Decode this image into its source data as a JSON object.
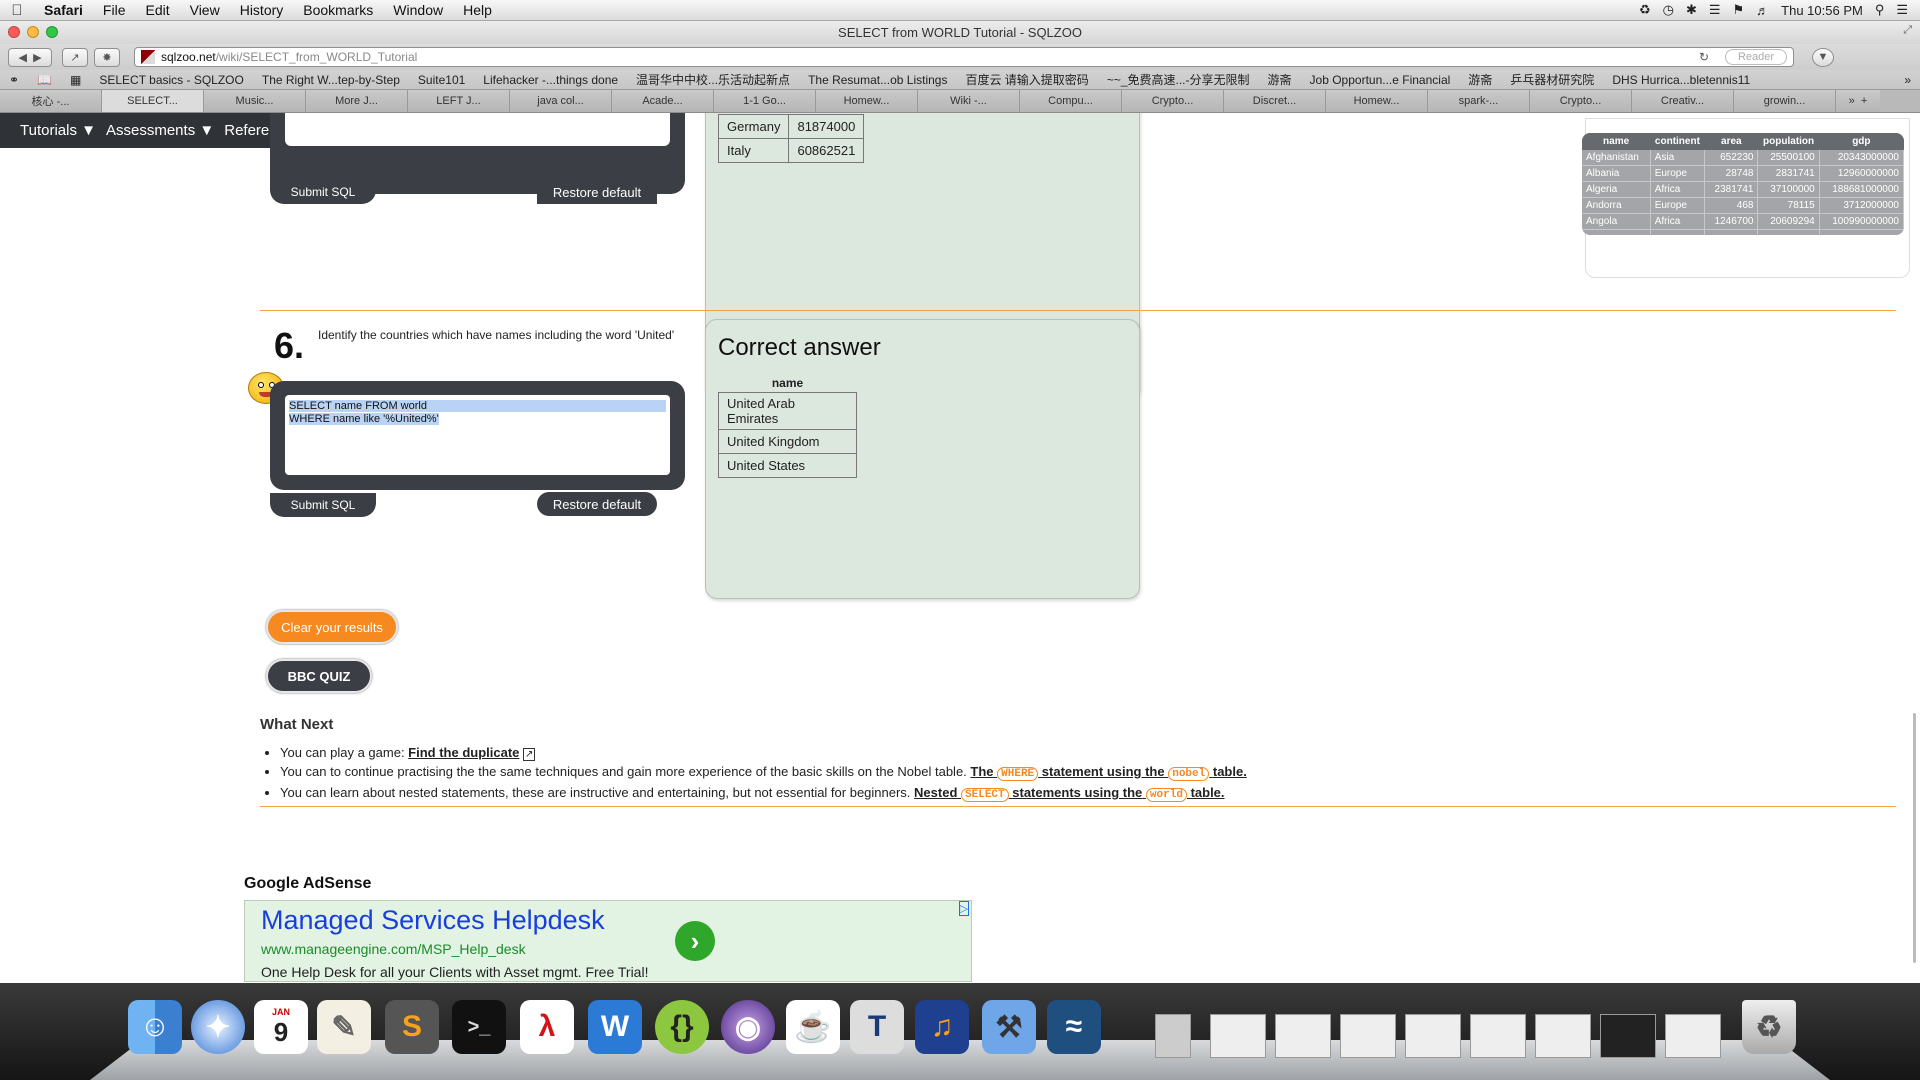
{
  "menubar": {
    "app": "Safari",
    "items": [
      "File",
      "Edit",
      "View",
      "History",
      "Bookmarks",
      "Window",
      "Help"
    ],
    "clock": "Thu 10:56 PM"
  },
  "window": {
    "title": "SELECT from WORLD Tutorial - SQLZOO"
  },
  "toolbar": {
    "url_domain": "sqlzoo.net",
    "url_path": "/wiki/SELECT_from_WORLD_Tutorial",
    "reader_label": "Reader"
  },
  "bookmarks": [
    "SELECT basics - SQLZOO",
    "The Right W...tep-by-Step",
    "Suite101",
    "Lifehacker -...things done",
    "温哥华中中校...乐活动起新点",
    "The Resumat...ob Listings",
    "百度云 请输入提取密码",
    "~~_免费高速...-分享无限制",
    "游斋",
    "Job Opportun...e Financial",
    "游斋",
    "乒乓器材研究院",
    "DHS Hurrica...bletennis11"
  ],
  "tabs": [
    "核心 -...",
    "SELECT...",
    "Music...",
    "More J...",
    "LEFT J...",
    "java col...",
    "Acade...",
    "1-1 Go...",
    "Homew...",
    "Wiki -...",
    "Compu...",
    "Crypto...",
    "Discret...",
    "Homew...",
    "spark-...",
    "Crypto...",
    "Creativ...",
    "growin..."
  ],
  "nav": {
    "tutorials": "Tutorials",
    "assessments": "Assessments",
    "reference": "Reference",
    "arrow": "▼"
  },
  "q5": {
    "submit": "Submit SQL",
    "restore": "Restore default",
    "rows": [
      [
        "Germany",
        "81874000"
      ],
      [
        "Italy",
        "60862521"
      ]
    ]
  },
  "q6": {
    "number": "6.",
    "question": "Identify the countries which have names including the word 'United'",
    "sql_line1": "SELECT name FROM world",
    "sql_line2": "WHERE name like '%United%'",
    "submit": "Submit SQL",
    "restore": "Restore default",
    "answer_title": "Correct answer",
    "answer_header": "name",
    "answer_rows": [
      "United Arab Emirates",
      "United Kingdom",
      "United States"
    ]
  },
  "buttons": {
    "clear": "Clear your results",
    "bbc": "BBC QUIZ"
  },
  "what_next": {
    "heading": "What Next",
    "item1_text": "You can play a game: ",
    "item1_link": "Find the duplicate",
    "item2_text": "You can to continue practising the the same techniques and gain more experience of the basic skills on the Nobel table. ",
    "item2_link_a": "The",
    "item2_code1": "WHERE",
    "item2_link_b": "statement using the",
    "item2_code2": "nobel",
    "item2_link_c": "table.",
    "item3_text": "You can learn about nested statements, these are instructive and entertaining, but not essential for beginners. ",
    "item3_link_a": "Nested",
    "item3_code1": "SELECT",
    "item3_link_b": "statements using the",
    "item3_code2": "world",
    "item3_link_c": "table."
  },
  "world_table": {
    "headers": [
      "name",
      "continent",
      "area",
      "population",
      "gdp"
    ],
    "rows": [
      [
        "Afghanistan",
        "Asia",
        "652230",
        "25500100",
        "20343000000"
      ],
      [
        "Albania",
        "Europe",
        "28748",
        "2831741",
        "12960000000"
      ],
      [
        "Algeria",
        "Africa",
        "2381741",
        "37100000",
        "188681000000"
      ],
      [
        "Andorra",
        "Europe",
        "468",
        "78115",
        "3712000000"
      ],
      [
        "Angola",
        "Africa",
        "1246700",
        "20609294",
        "100990000000"
      ]
    ],
    "ellipsis": "..."
  },
  "adsense": {
    "label": "Google AdSense",
    "title": "Managed Services Helpdesk",
    "url": "www.manageengine.com/MSP_Help_desk",
    "desc": "One Help Desk for all your Clients with Asset mgmt. Free Trial!"
  },
  "dock": {
    "calendar_month": "JAN",
    "calendar_day": "9"
  },
  "colors": {
    "panel": "#3b3e44",
    "accent_orange": "#f6891f",
    "answer_bg": "#dce7dd",
    "ad_title": "#1a3edb",
    "ad_url": "#1a8a2a"
  }
}
